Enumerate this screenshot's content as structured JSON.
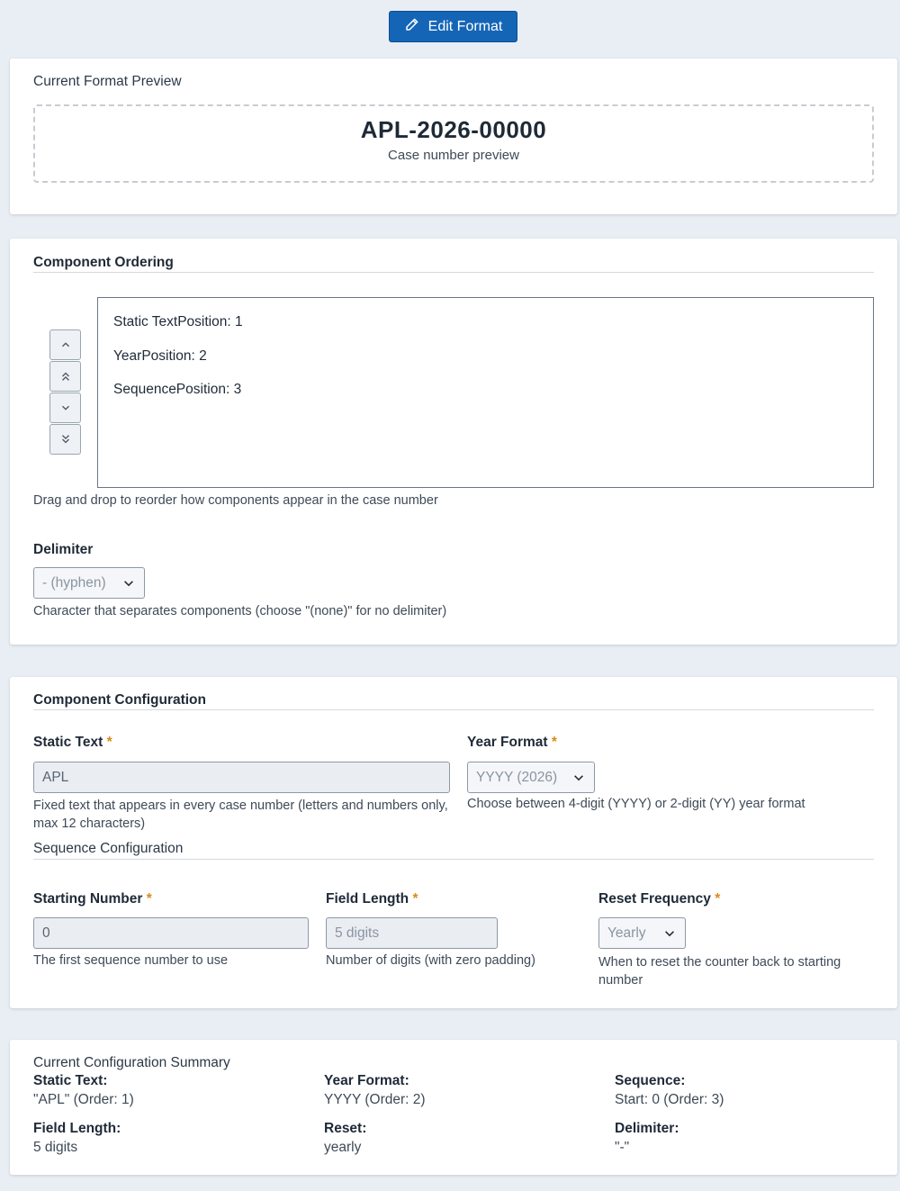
{
  "header": {
    "edit_button_label": "Edit Format"
  },
  "preview": {
    "title": "Current Format Preview",
    "value": "APL-2026-00000",
    "caption": "Case number preview"
  },
  "ordering": {
    "title": "Component Ordering",
    "items": [
      {
        "label": "Static TextPosition: 1"
      },
      {
        "label": "YearPosition: 2"
      },
      {
        "label": "SequencePosition: 3"
      }
    ],
    "help": "Drag and drop to reorder how components appear in the case number",
    "delimiter_label": "Delimiter",
    "delimiter_value": "- (hyphen)",
    "delimiter_help": "Character that separates components (choose \"(none)\" for no delimiter)"
  },
  "config": {
    "title": "Component Configuration",
    "static_text_label": "Static Text",
    "static_text_value": "APL",
    "static_text_help_line1": "Fixed text that appears in every case number (letters and numbers only,",
    "static_text_help_line2": "max 12 characters)",
    "year_format_label": "Year Format",
    "year_format_value": "YYYY (2026)",
    "year_format_help": "Choose between 4-digit (YYYY) or 2-digit (YY) year format",
    "required_marker": "*",
    "sequence_title": "Sequence Configuration",
    "starting_number_label": "Starting Number",
    "starting_number_value": "0",
    "starting_number_help": "The first sequence number to use",
    "field_length_label": "Field Length",
    "field_length_value": "5 digits",
    "field_length_help": "Number of digits (with zero padding)",
    "reset_frequency_label": "Reset Frequency",
    "reset_frequency_value": "Yearly",
    "reset_frequency_help_line1": "When to reset the counter back to starting",
    "reset_frequency_help_line2": "number"
  },
  "summary": {
    "title": "Current Configuration Summary",
    "static_text_key": "Static Text:",
    "static_text_val": "\"APL\" (Order: 1)",
    "year_format_key": "Year Format:",
    "year_format_val": "YYYY (Order: 2)",
    "sequence_key": "Sequence:",
    "sequence_val": "Start: 0 (Order: 3)",
    "field_length_key": "Field Length:",
    "field_length_val": "5 digits",
    "reset_key": "Reset:",
    "reset_val": "yearly",
    "delimiter_key": "Delimiter:",
    "delimiter_val": "\"-\""
  },
  "colors": {
    "accent": "#1565b7",
    "required": "#d98b1a",
    "background": "#e9eef5"
  }
}
